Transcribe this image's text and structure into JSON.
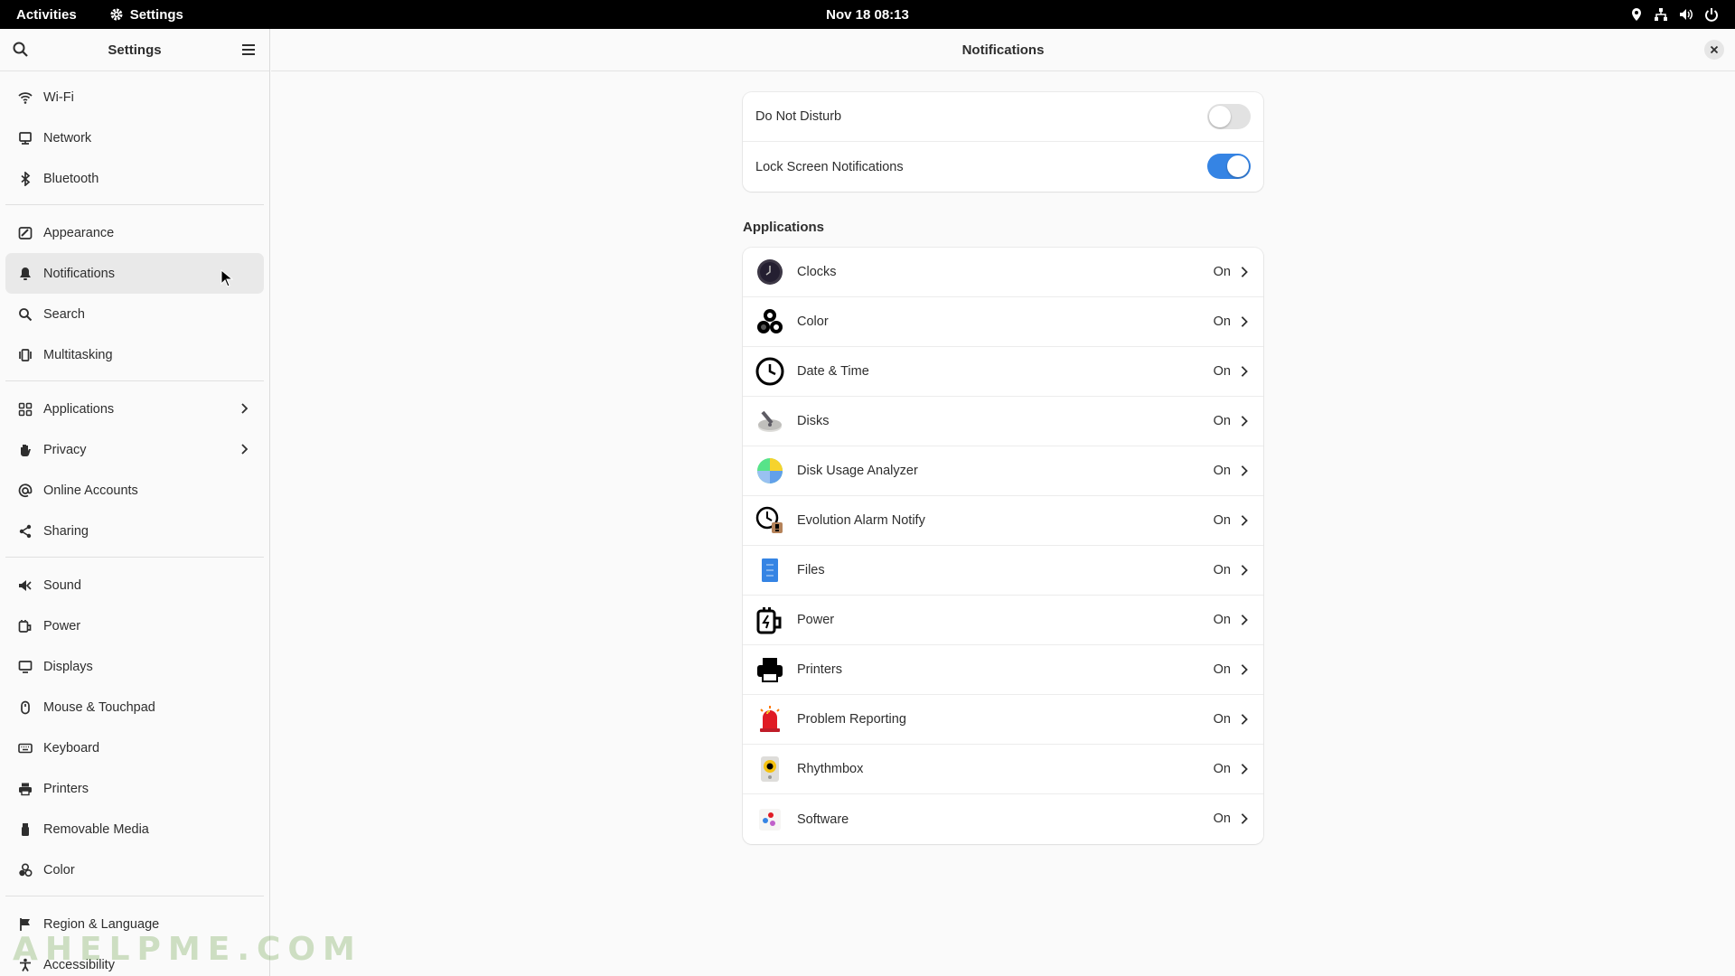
{
  "topbar": {
    "activities": "Activities",
    "app_name": "Settings",
    "datetime": "Nov 18  08:13",
    "icons": [
      "location-icon",
      "network-icon",
      "volume-icon",
      "power-icon"
    ]
  },
  "sidebar": {
    "title": "Settings",
    "items": [
      {
        "label": "Wi-Fi",
        "icon": "wifi-icon"
      },
      {
        "label": "Network",
        "icon": "network-icon"
      },
      {
        "label": "Bluetooth",
        "icon": "bluetooth-icon"
      },
      {
        "label": "Appearance",
        "icon": "appearance-icon"
      },
      {
        "label": "Notifications",
        "icon": "bell-icon",
        "selected": true
      },
      {
        "label": "Search",
        "icon": "search-icon"
      },
      {
        "label": "Multitasking",
        "icon": "multitasking-icon"
      },
      {
        "label": "Applications",
        "icon": "applications-icon",
        "has_submenu": true
      },
      {
        "label": "Privacy",
        "icon": "privacy-icon",
        "has_submenu": true
      },
      {
        "label": "Online Accounts",
        "icon": "online-accounts-icon"
      },
      {
        "label": "Sharing",
        "icon": "sharing-icon"
      },
      {
        "label": "Sound",
        "icon": "sound-icon"
      },
      {
        "label": "Power",
        "icon": "power-icon"
      },
      {
        "label": "Displays",
        "icon": "displays-icon"
      },
      {
        "label": "Mouse & Touchpad",
        "icon": "mouse-icon"
      },
      {
        "label": "Keyboard",
        "icon": "keyboard-icon"
      },
      {
        "label": "Printers",
        "icon": "printer-icon"
      },
      {
        "label": "Removable Media",
        "icon": "removable-media-icon"
      },
      {
        "label": "Color",
        "icon": "color-icon"
      },
      {
        "label": "Region & Language",
        "icon": "flag-icon"
      },
      {
        "label": "Accessibility",
        "icon": "accessibility-icon"
      }
    ]
  },
  "main": {
    "title": "Notifications",
    "settings": [
      {
        "label": "Do Not Disturb",
        "enabled": false
      },
      {
        "label": "Lock Screen Notifications",
        "enabled": true
      }
    ],
    "applications_title": "Applications",
    "applications": [
      {
        "name": "Clocks",
        "state": "On",
        "icon": "clocks-icon"
      },
      {
        "name": "Color",
        "state": "On",
        "icon": "color-icon"
      },
      {
        "name": "Date & Time",
        "state": "On",
        "icon": "date-time-icon"
      },
      {
        "name": "Disks",
        "state": "On",
        "icon": "disks-icon"
      },
      {
        "name": "Disk Usage Analyzer",
        "state": "On",
        "icon": "disk-usage-analyzer-icon"
      },
      {
        "name": "Evolution Alarm Notify",
        "state": "On",
        "icon": "evolution-alarm-icon"
      },
      {
        "name": "Files",
        "state": "On",
        "icon": "files-icon"
      },
      {
        "name": "Power",
        "state": "On",
        "icon": "power-icon"
      },
      {
        "name": "Printers",
        "state": "On",
        "icon": "printer-icon"
      },
      {
        "name": "Problem Reporting",
        "state": "On",
        "icon": "problem-reporting-icon"
      },
      {
        "name": "Rhythmbox",
        "state": "On",
        "icon": "rhythmbox-icon"
      },
      {
        "name": "Software",
        "state": "On",
        "icon": "software-icon"
      }
    ]
  },
  "watermark": "AHELPME.COM",
  "colors": {
    "accent": "#3584e4",
    "topbar": "#000000",
    "selected": "#e9e9e9"
  }
}
